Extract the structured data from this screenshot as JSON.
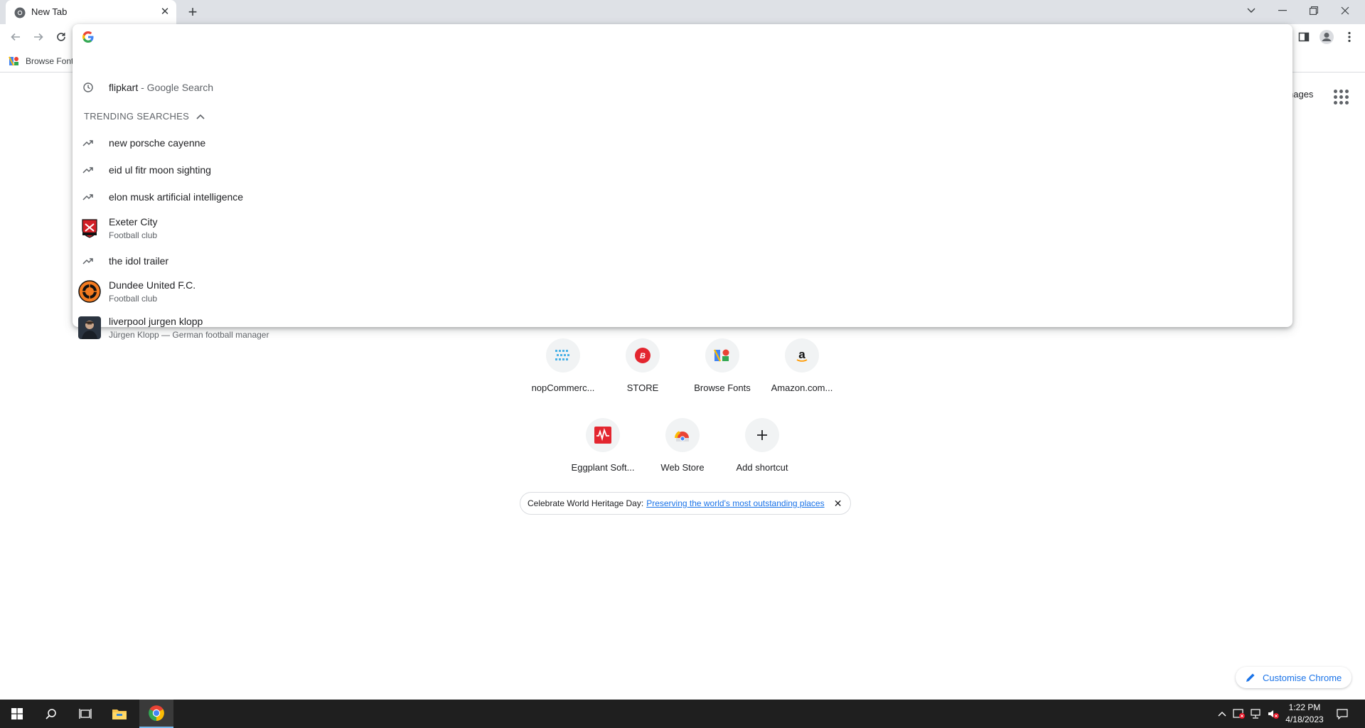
{
  "browser": {
    "tab": {
      "title": "New Tab",
      "close": "✕"
    },
    "new_tab": "+",
    "bookmarks": [
      {
        "label": "Browse Fonts"
      }
    ]
  },
  "omnibox": {
    "value": "",
    "placeholder": "",
    "history": [
      {
        "query": "flipkart",
        "suffix": " - Google Search"
      }
    ],
    "trending_header": "TRENDING SEARCHES",
    "suggestions": [
      {
        "type": "trend",
        "title": "new porsche cayenne"
      },
      {
        "type": "trend",
        "title": "eid ul fitr moon sighting"
      },
      {
        "type": "trend",
        "title": "elon musk artificial intelligence"
      },
      {
        "type": "entity",
        "title": "Exeter City",
        "subtitle": "Football club"
      },
      {
        "type": "trend",
        "title": "the idol trailer"
      },
      {
        "type": "entity",
        "title": "Dundee United F.C.",
        "subtitle": "Football club"
      },
      {
        "type": "entity",
        "title": "liverpool jurgen klopp",
        "subtitle": "Jürgen Klopp — German football manager"
      }
    ]
  },
  "page": {
    "images_link": "nages",
    "shortcuts": [
      {
        "label": "nopCommerc..."
      },
      {
        "label": "STORE"
      },
      {
        "label": "Browse Fonts"
      },
      {
        "label": "Amazon.com..."
      },
      {
        "label": "Eggplant Soft..."
      },
      {
        "label": "Web Store"
      },
      {
        "label": "Add shortcut"
      }
    ],
    "promo": {
      "text": "Celebrate World Heritage Day:",
      "link": "Preserving the world's most outstanding places",
      "close": "✕"
    },
    "customise": "Customise Chrome"
  },
  "taskbar": {
    "time": "1:22 PM",
    "date": "4/18/2023"
  },
  "colors": {
    "accent": "#1a73e8",
    "tabstrip": "#dee1e6",
    "taskbar": "#1f1f1f"
  }
}
